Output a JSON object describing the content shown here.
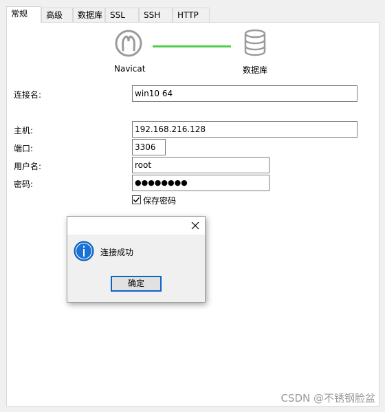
{
  "tabs": [
    {
      "label": "常规",
      "active": true
    },
    {
      "label": "高级",
      "active": false
    },
    {
      "label": "数据库",
      "active": false
    },
    {
      "label": "SSL",
      "active": false
    },
    {
      "label": "SSH",
      "active": false
    },
    {
      "label": "HTTP",
      "active": false
    }
  ],
  "flow": {
    "client_label": "Navicat",
    "server_label": "数据库",
    "line_color": "#4cd04c",
    "client_icon": "navicat-icon",
    "server_icon": "database-icon"
  },
  "form": {
    "connection_name_label": "连接名:",
    "connection_name_value": "win10 64",
    "host_label": "主机:",
    "host_value": "192.168.216.128",
    "port_label": "端口:",
    "port_value": "3306",
    "username_label": "用户名:",
    "username_value": "root",
    "password_label": "密码:",
    "password_value": "●●●●●●●●",
    "save_password_label": "保存密码",
    "save_password_checked": true
  },
  "dialog": {
    "message": "连接成功",
    "ok_label": "确定",
    "icon": "info-icon",
    "close_icon": "close-icon",
    "accent_color": "#0a64c8"
  },
  "watermark": "CSDN @不锈钢脸盆"
}
